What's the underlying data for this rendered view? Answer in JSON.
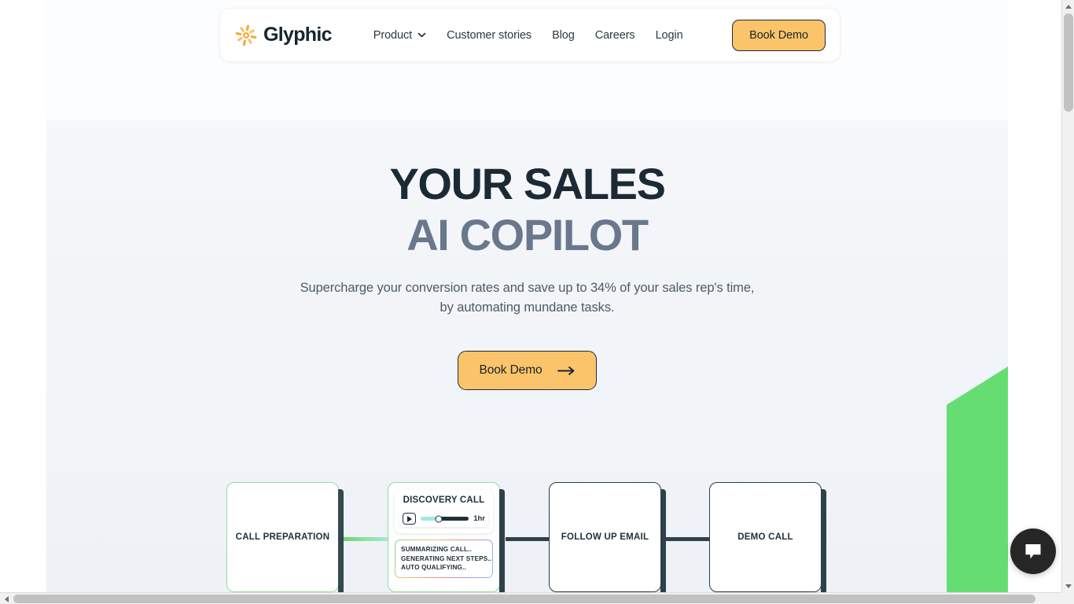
{
  "brand": {
    "name": "Glyphic",
    "logo_icon": "sunburst-icon",
    "accent_orange": "#fcc46a",
    "accent_dark": "#1d2b33",
    "accent_green": "#66dd73"
  },
  "nav": {
    "links": [
      {
        "label": "Product",
        "has_dropdown": true,
        "icon": "chevron-down-icon"
      },
      {
        "label": "Customer stories",
        "has_dropdown": false
      },
      {
        "label": "Blog",
        "has_dropdown": false
      },
      {
        "label": "Careers",
        "has_dropdown": false
      },
      {
        "label": "Login",
        "has_dropdown": false
      }
    ],
    "cta_label": "Book Demo"
  },
  "hero": {
    "title_line1": "YOUR SALES",
    "title_line2": "AI COPILOT",
    "title_line1_color": "#1b2b35",
    "title_line2_color": "#69788c",
    "subtitle": "Supercharge your conversion rates and save up to 34% of your sales rep's time, by automating mundane tasks.",
    "cta_label": "Book Demo",
    "cta_icon": "arrow-right-icon"
  },
  "flow": {
    "cards": [
      {
        "label": "CALL PREPARATION",
        "accent": "green"
      },
      {
        "label": "DISCOVERY CALL",
        "accent": "green"
      },
      {
        "label": "FOLLOW UP EMAIL",
        "accent": "dark"
      },
      {
        "label": "DEMO CALL",
        "accent": "dark"
      }
    ],
    "discovery": {
      "title": "DISCOVERY CALL",
      "play_icon": "play-icon",
      "duration": "1hr",
      "progress_percent": 38,
      "status_lines": [
        "SUMMARIZING CALL..",
        "GENERATING NEXT STEPS..",
        "AUTO QUALIFYING.."
      ]
    }
  },
  "chat": {
    "icon": "chat-bubble-icon",
    "label": "Open chat"
  },
  "scrollbars": {
    "vertical_icon_up": "scroll-up-icon",
    "vertical_icon_down": "scroll-down-icon",
    "horizontal_icon_left": "scroll-left-icon",
    "horizontal_icon_right": "scroll-right-icon"
  }
}
